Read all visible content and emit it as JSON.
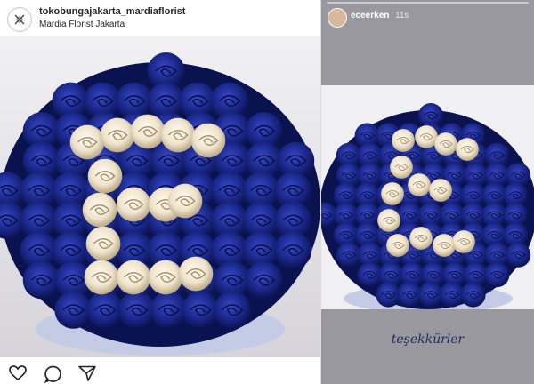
{
  "post": {
    "username": "tokobungajakarta_mardiaflorist",
    "location": "Mardia Florist Jakarta",
    "photo_subject": "blue-and-white-rose-letter-E",
    "icons": [
      "heart-icon",
      "comment-icon",
      "share-icon"
    ]
  },
  "story": {
    "username": "eceerken",
    "time": "11s",
    "caption": "teşekkürler",
    "photo_subject": "blue-and-white-rose-letter-E"
  },
  "colors": {
    "rose_blue": "#1c2a8f",
    "rose_cream": "#efe4cc",
    "story_background": "#9a989f",
    "caption_text": "#1e2a55"
  }
}
